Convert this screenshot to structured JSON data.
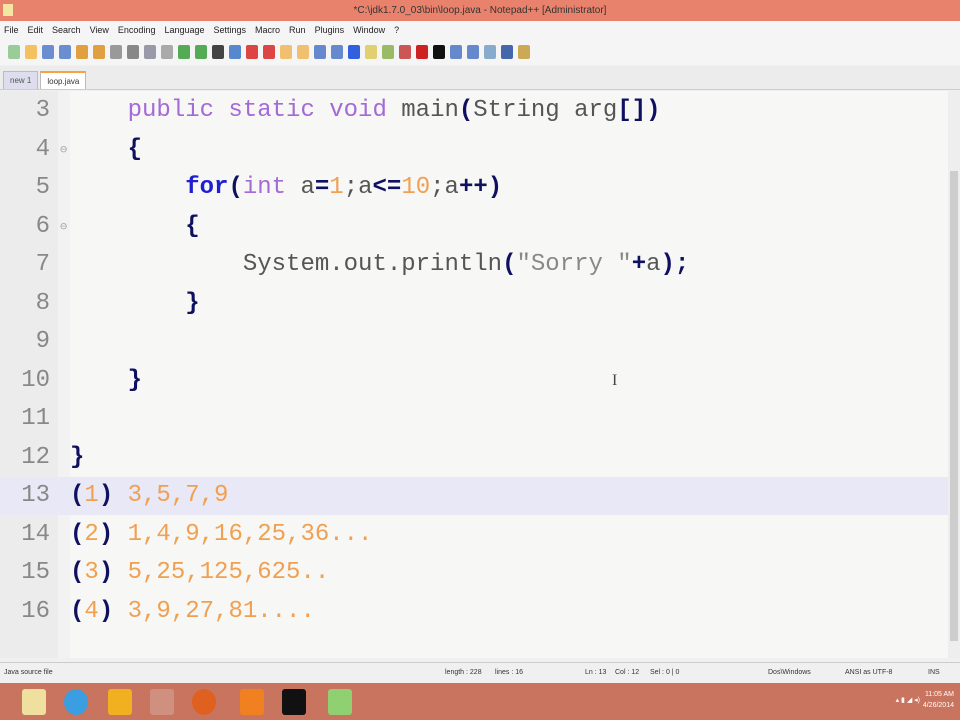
{
  "window": {
    "title": "*C:\\jdk1.7.0_03\\bin\\loop.java - Notepad++ [Administrator]"
  },
  "menu": [
    "File",
    "Edit",
    "Search",
    "View",
    "Encoding",
    "Language",
    "Settings",
    "Macro",
    "Run",
    "Plugins",
    "Window",
    "?"
  ],
  "tabs": [
    {
      "label": "new 1"
    },
    {
      "label": "loop.java"
    }
  ],
  "editor": {
    "lines": [
      {
        "n": "3",
        "tokens": [
          [
            "    ",
            ""
          ],
          [
            "public static void",
            "kw"
          ],
          [
            " main",
            "id"
          ],
          [
            "(",
            "br"
          ],
          [
            "String arg",
            "id"
          ],
          [
            "[]",
            "br"
          ],
          [
            ")",
            "br"
          ]
        ]
      },
      {
        "n": "4",
        "fold": true,
        "tokens": [
          [
            "    ",
            ""
          ],
          [
            "{",
            "br"
          ]
        ]
      },
      {
        "n": "5",
        "tokens": [
          [
            "        ",
            ""
          ],
          [
            "for",
            "kw2"
          ],
          [
            "(",
            "br"
          ],
          [
            "int",
            "kw"
          ],
          [
            " a",
            "id"
          ],
          [
            "=",
            "op"
          ],
          [
            "1",
            "num"
          ],
          [
            ";a",
            "id"
          ],
          [
            "<=",
            "op"
          ],
          [
            "10",
            "num"
          ],
          [
            ";a",
            "id"
          ],
          [
            "++",
            "op"
          ],
          [
            ")",
            "br"
          ]
        ]
      },
      {
        "n": "6",
        "fold": true,
        "tokens": [
          [
            "        ",
            ""
          ],
          [
            "{",
            "br"
          ]
        ]
      },
      {
        "n": "7",
        "tokens": [
          [
            "            ",
            ""
          ],
          [
            "System.out.println",
            "id"
          ],
          [
            "(",
            "br"
          ],
          [
            "\"Sorry \"",
            "str"
          ],
          [
            "+",
            "op"
          ],
          [
            "a",
            "id"
          ],
          [
            ");",
            "br"
          ]
        ]
      },
      {
        "n": "8",
        "tokens": [
          [
            "        ",
            ""
          ],
          [
            "}",
            "br"
          ]
        ]
      },
      {
        "n": "9",
        "tokens": []
      },
      {
        "n": "10",
        "tokens": [
          [
            "    ",
            ""
          ],
          [
            "}",
            "br"
          ]
        ]
      },
      {
        "n": "11",
        "tokens": []
      },
      {
        "n": "12",
        "tokens": [
          [
            "}",
            "br"
          ]
        ]
      },
      {
        "n": "13",
        "hl": true,
        "tokens": [
          [
            "(",
            "br"
          ],
          [
            "1",
            "num"
          ],
          [
            ")",
            "br"
          ],
          [
            " 3,5,7,9",
            "num"
          ]
        ]
      },
      {
        "n": "14",
        "tokens": [
          [
            "(",
            "br"
          ],
          [
            "2",
            "num"
          ],
          [
            ")",
            "br"
          ],
          [
            " 1,4,9,16,25,36...",
            "num"
          ]
        ]
      },
      {
        "n": "15",
        "tokens": [
          [
            "(",
            "br"
          ],
          [
            "3",
            "num"
          ],
          [
            ")",
            "br"
          ],
          [
            " 5,25,125,625..",
            "num"
          ]
        ]
      },
      {
        "n": "16",
        "tokens": [
          [
            "(",
            "br"
          ],
          [
            "4",
            "num"
          ],
          [
            ")",
            "br"
          ],
          [
            " 3,9,27,81....",
            "num"
          ]
        ]
      }
    ]
  },
  "status": {
    "file_type": "Java source file",
    "length": "length : 228",
    "lines": "lines : 16",
    "ln": "Ln : 13",
    "col": "Col : 12",
    "sel": "Sel : 0 | 0",
    "eol": "Dos\\Windows",
    "encoding": "ANSI as UTF-8",
    "mode": "INS"
  },
  "taskbar": {
    "time": "11:05 AM",
    "date": "4/26/2014"
  }
}
